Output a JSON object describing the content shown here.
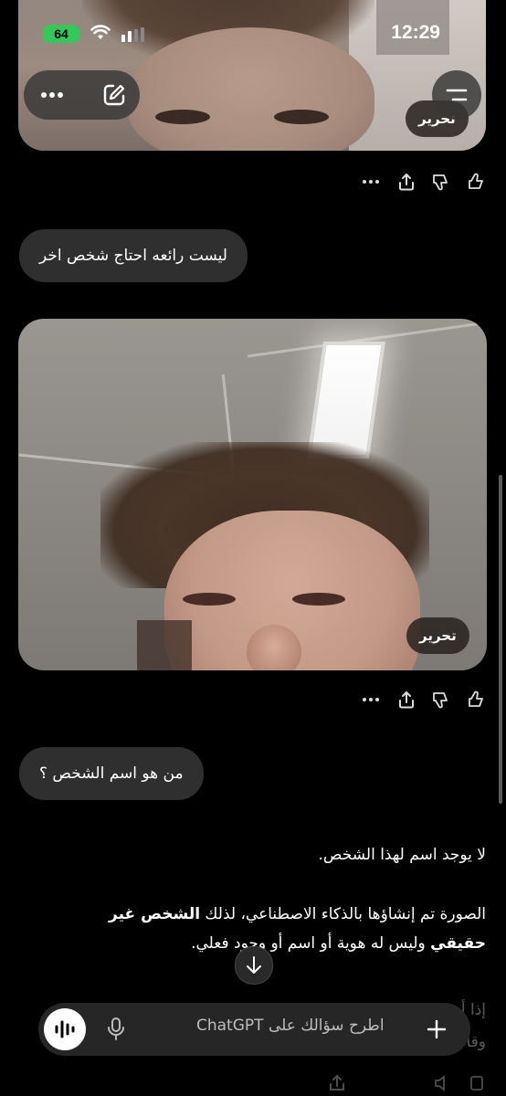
{
  "status_bar": {
    "time": "12:29",
    "battery": "64"
  },
  "images": {
    "top_edit_label": "تحرير",
    "main_edit_label": "تحرير"
  },
  "messages": {
    "user_1": "ليست رائعه احتاج شخص اخر",
    "user_2": "من هو اسم الشخص ؟",
    "answer_line_1": "لا يوجد اسم لهذا الشخص.",
    "answer_p2_prefix": "الصورة تم إنشاؤها بالذكاء الاصطناعي، لذلك ",
    "answer_p2_bold": "الشخص غير",
    "answer_p2_line2_bold": "حقيقي",
    "answer_p2_line2": " وليس له هوية أو اسم أو وجود فعلي.",
    "answer_p3_partial": "إذا أردت",
    "answer_p3_partial_2": "وقا"
  },
  "composer": {
    "placeholder": "اطرح سؤالك على ChatGPT"
  },
  "icons": {
    "more": "more-icon",
    "share": "share-icon",
    "thumbs_down": "thumbs-down-icon",
    "thumbs_up": "thumbs-up-icon",
    "edit": "new-chat-icon",
    "menu": "menu-icon",
    "mic": "mic-icon",
    "voice": "voice-mode-icon",
    "plus": "plus-icon",
    "arrow_down": "arrow-down-icon"
  }
}
